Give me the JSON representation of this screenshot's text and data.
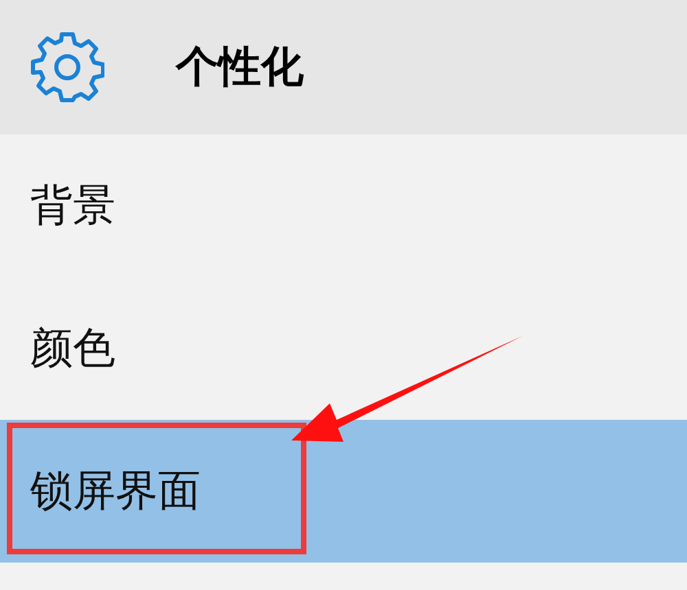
{
  "header": {
    "title": "个性化"
  },
  "nav_items": [
    {
      "label": "背景",
      "selected": false
    },
    {
      "label": "颜色",
      "selected": false
    },
    {
      "label": "锁屏界面",
      "selected": true
    }
  ]
}
